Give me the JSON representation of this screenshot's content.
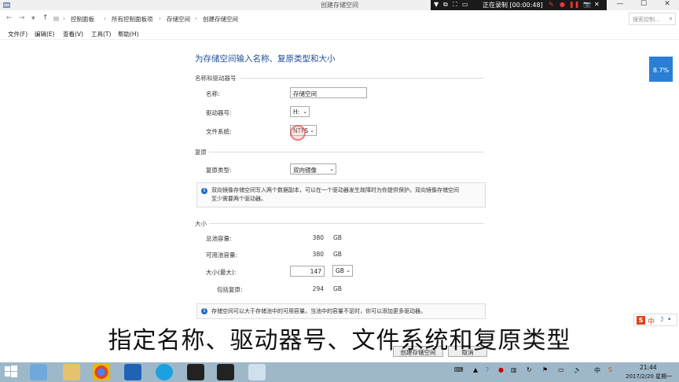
{
  "window": {
    "title": "创建存储空间",
    "recording": {
      "status": "正在录制 [00:00:48]"
    },
    "controls": {
      "minimize": "—",
      "maximize": "☐",
      "close": "✕"
    }
  },
  "address_bar": {
    "breadcrumb": [
      "控制面板",
      "所有控制面板项",
      "存储空间",
      "创建存储空间"
    ],
    "search_placeholder": "搜索控制..."
  },
  "menu": [
    "文件(F)",
    "编辑(E)",
    "查看(V)",
    "工具(T)",
    "帮助(H)"
  ],
  "form": {
    "heading": "为存储空间输入名称、复原类型和大小",
    "name_section": {
      "title": "名称和驱动器号",
      "name_label": "名称:",
      "name_value": "存储空间",
      "drive_label": "驱动器号:",
      "drive_value": "H:",
      "fs_label": "文件系统:",
      "fs_value": "NTFS"
    },
    "resiliency_section": {
      "title": "复原",
      "type_label": "复原类型:",
      "type_value": "双向镜像",
      "info_line1": "双向镜像存储空间写入两个数据副本，可以在一个驱动器发生故障时为你提供保护。双向镜像存储空间",
      "info_line2": "至少需要两个驱动器。"
    },
    "size_section": {
      "title": "大小",
      "total_label": "总池容量:",
      "total_value": "380",
      "total_unit": "GB",
      "available_label": "可用池容量:",
      "available_value": "380",
      "available_unit": "GB",
      "size_label": "大小(最大):",
      "size_value": "147",
      "size_unit": "GB",
      "incl_label": "包括复原:",
      "incl_value": "294",
      "incl_unit": "GB",
      "info_text": "存储空间可以大于存储池中的可用容量。当池中的容量不足时，你可以添加更多驱动器。"
    },
    "buttons": {
      "create": "创建存储空间",
      "cancel": "取消"
    }
  },
  "side_badge": "8.7%",
  "subtitle": "指定名称、驱动器号、文件系统和复原类型",
  "ime": {
    "logo": "S",
    "lang": "中"
  },
  "taskbar": {
    "tray_lang": "中",
    "time": "21:44",
    "date": "2017/2/20 星期一"
  },
  "colors": {
    "heading": "#1e4e9a",
    "taskbar": "#9fb8c9",
    "badge": "#2a7fd4"
  }
}
